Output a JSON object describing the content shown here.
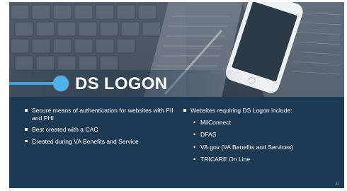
{
  "slide": {
    "title": "DS LOGON",
    "page_number": "22",
    "left_bullets": [
      "Secure means of authentication for websites with PII and PHI",
      "Best created with a CAC",
      "Created during VA Benefits and Service"
    ],
    "right_heading": "Websites requiring DS Logon include:",
    "right_sub_bullets": [
      "MilConnect",
      "DFAS",
      "VA.gov (VA Benefits and Services)",
      "TRICARE On Line"
    ]
  },
  "colors": {
    "background": "#1d3a52",
    "accent": "#4eb3ea",
    "text": "#ffffff"
  },
  "icons": {
    "accent": "circle-accent-icon",
    "bullet": "square-bullet-icon"
  }
}
